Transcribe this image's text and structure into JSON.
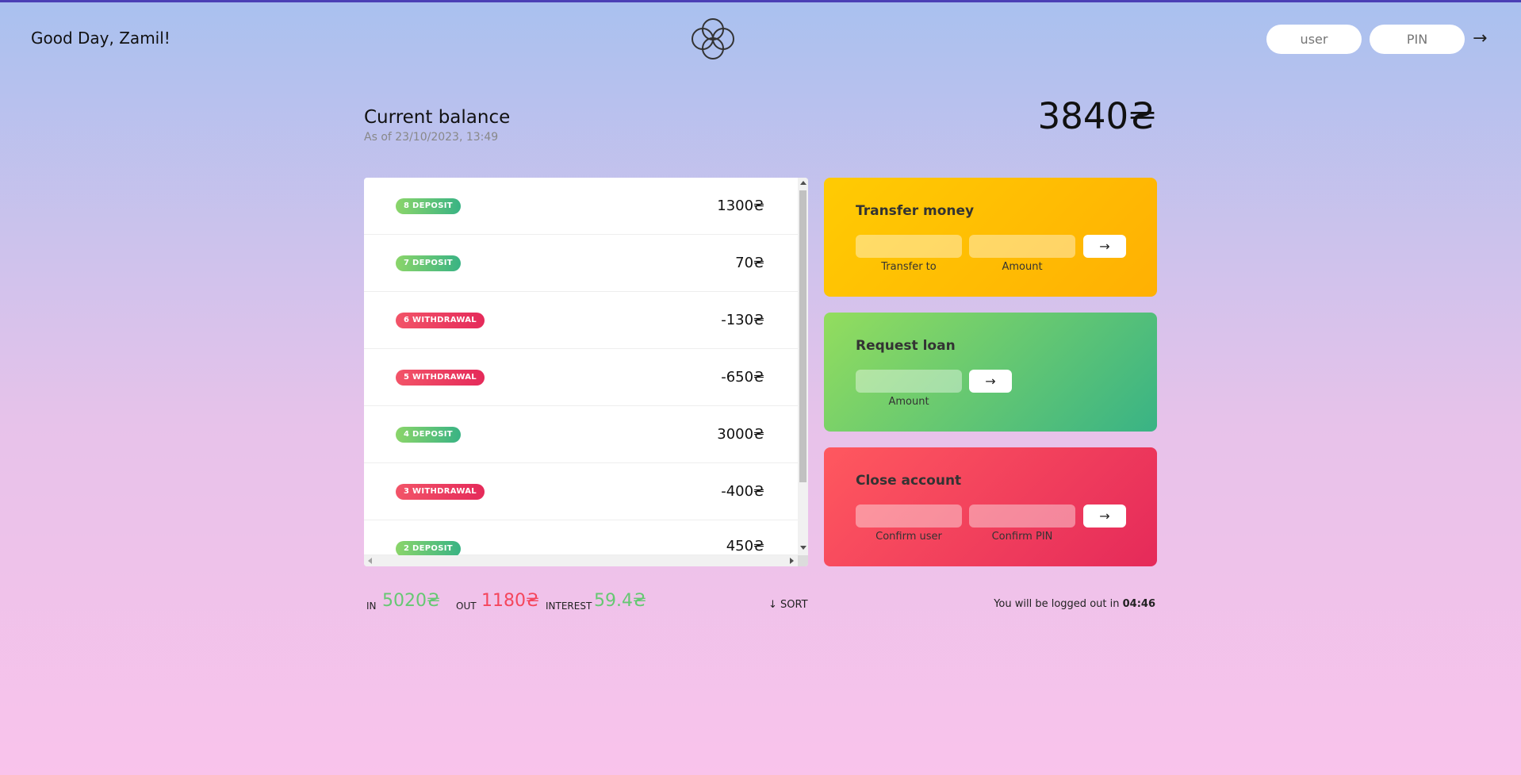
{
  "nav": {
    "welcome": "Good Day, Zamil!",
    "login_user_placeholder": "user",
    "login_pin_placeholder": "PIN",
    "login_button": "→"
  },
  "balance": {
    "label": "Current balance",
    "date": "As of 23/10/2023, 13:49",
    "value": "3840₴"
  },
  "movements": [
    {
      "type": "deposit",
      "label": "8 DEPOSIT",
      "value": "1300₴"
    },
    {
      "type": "deposit",
      "label": "7 DEPOSIT",
      "value": "70₴"
    },
    {
      "type": "withdrawal",
      "label": "6 WITHDRAWAL",
      "value": "-130₴"
    },
    {
      "type": "withdrawal",
      "label": "5 WITHDRAWAL",
      "value": "-650₴"
    },
    {
      "type": "deposit",
      "label": "4 DEPOSIT",
      "value": "3000₴"
    },
    {
      "type": "withdrawal",
      "label": "3 WITHDRAWAL",
      "value": "-400₴"
    },
    {
      "type": "deposit",
      "label": "2 DEPOSIT",
      "value": "450₴"
    }
  ],
  "operations": {
    "transfer": {
      "title": "Transfer money",
      "label_to": "Transfer to",
      "label_amount": "Amount",
      "button": "→"
    },
    "loan": {
      "title": "Request loan",
      "label_amount": "Amount",
      "button": "→"
    },
    "close": {
      "title": "Close account",
      "label_user": "Confirm user",
      "label_pin": "Confirm PIN",
      "button": "→"
    }
  },
  "summary": {
    "in_label": "In",
    "in_value": "5020₴",
    "out_label": "Out",
    "out_value": "1180₴",
    "interest_label": "Interest",
    "interest_value": "59.4₴",
    "sort_button": "↓ SORT"
  },
  "logout": {
    "text": "You will be logged out in ",
    "timer": "04:46"
  },
  "colors": {
    "deposit": "#39b384",
    "withdrawal": "#e52a5a",
    "transfer": "#ffb003",
    "loan": "#39b385",
    "close": "#e52a5a",
    "accent": "#4a3fb5"
  }
}
